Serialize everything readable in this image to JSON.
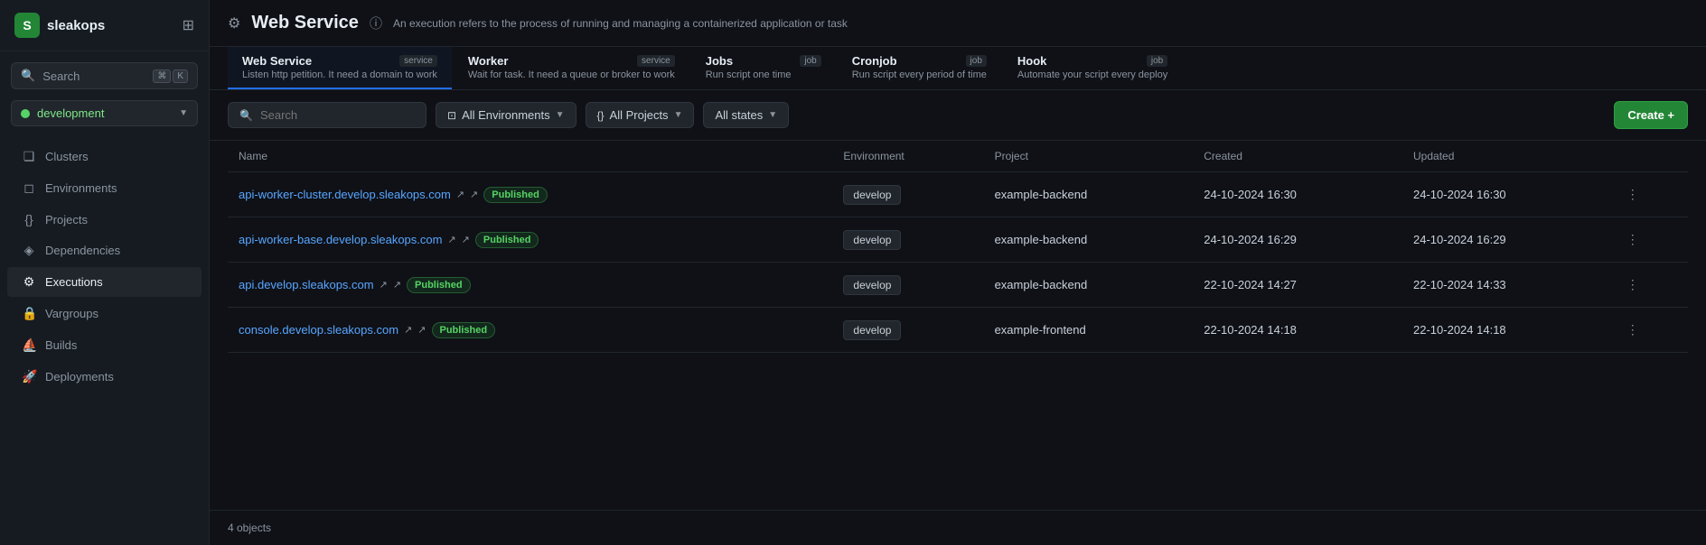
{
  "app": {
    "name": "sleakops",
    "logo_letter": "S"
  },
  "sidebar": {
    "search_label": "Search",
    "search_shortcut_1": "⌘",
    "search_shortcut_2": "K",
    "env_name": "development",
    "nav_items": [
      {
        "id": "clusters",
        "label": "Clusters",
        "icon": "❏"
      },
      {
        "id": "environments",
        "label": "Environments",
        "icon": "◻"
      },
      {
        "id": "projects",
        "label": "Projects",
        "icon": "{}"
      },
      {
        "id": "dependencies",
        "label": "Dependencies",
        "icon": "◈"
      },
      {
        "id": "executions",
        "label": "Executions",
        "icon": "⚙",
        "active": true
      },
      {
        "id": "vargroups",
        "label": "Vargroups",
        "icon": "🔒"
      },
      {
        "id": "builds",
        "label": "Builds",
        "icon": "⛵"
      },
      {
        "id": "deployments",
        "label": "Deployments",
        "icon": "🚀"
      }
    ]
  },
  "page": {
    "title": "Web Service",
    "subtitle": "An execution refers to the process of running and managing a containerized application or task"
  },
  "tabs": [
    {
      "id": "web-service",
      "name": "Web Service",
      "type": "service",
      "desc": "Listen http petition. It need a domain to work",
      "active": true
    },
    {
      "id": "worker",
      "name": "Worker",
      "type": "service",
      "desc": "Wait for task. It need a queue or broker to work",
      "active": false
    },
    {
      "id": "jobs",
      "name": "Jobs",
      "type": "job",
      "desc": "Run script one time",
      "active": false
    },
    {
      "id": "cronjob",
      "name": "Cronjob",
      "type": "job",
      "desc": "Run script every period of time",
      "active": false
    },
    {
      "id": "hook",
      "name": "Hook",
      "type": "job",
      "desc": "Automate your script every deploy",
      "active": false
    }
  ],
  "toolbar": {
    "search_placeholder": "Search",
    "filter_env_label": "All Environments",
    "filter_project_label": "All Projects",
    "filter_state_label": "All states",
    "create_label": "Create +"
  },
  "table": {
    "columns": [
      "Name",
      "Environment",
      "Project",
      "Created",
      "Updated"
    ],
    "rows": [
      {
        "name": "api-worker-cluster.develop.sleakops.com",
        "status": "Published",
        "environment": "develop",
        "project": "example-backend",
        "created": "24-10-2024 16:30",
        "updated": "24-10-2024 16:30"
      },
      {
        "name": "api-worker-base.develop.sleakops.com",
        "status": "Published",
        "environment": "develop",
        "project": "example-backend",
        "created": "24-10-2024 16:29",
        "updated": "24-10-2024 16:29"
      },
      {
        "name": "api.develop.sleakops.com",
        "status": "Published",
        "environment": "develop",
        "project": "example-backend",
        "created": "22-10-2024 14:27",
        "updated": "22-10-2024 14:33"
      },
      {
        "name": "console.develop.sleakops.com",
        "status": "Published",
        "environment": "develop",
        "project": "example-frontend",
        "created": "22-10-2024 14:18",
        "updated": "22-10-2024 14:18"
      }
    ],
    "footer": "4 objects"
  }
}
